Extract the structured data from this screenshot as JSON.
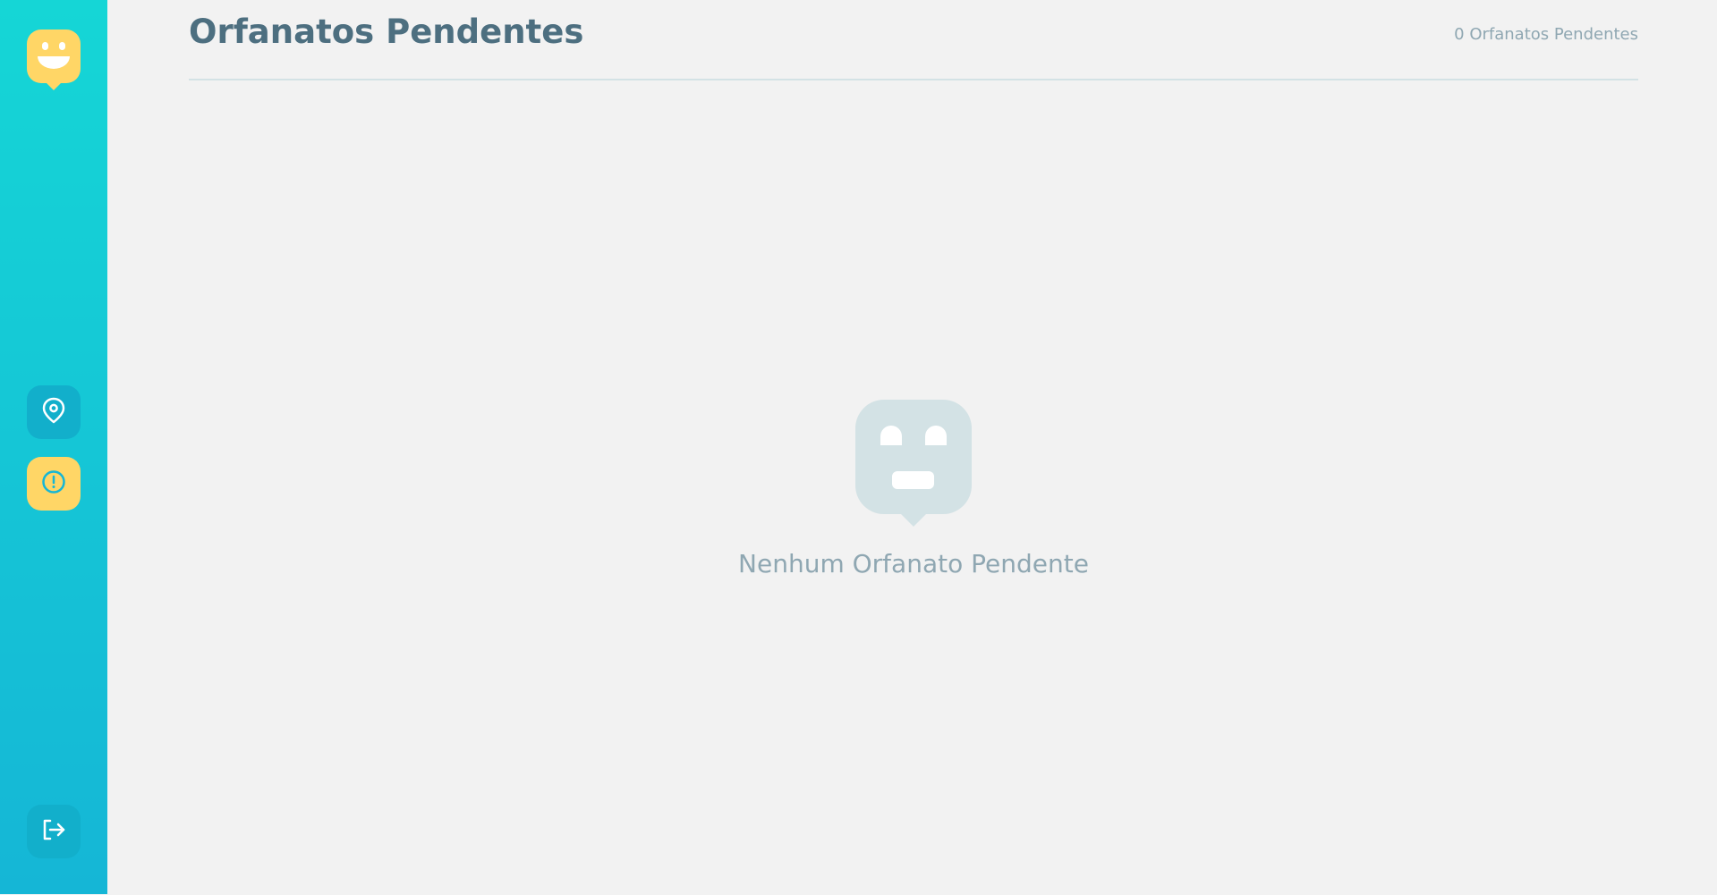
{
  "sidebar": {
    "logo_icon": "happy-face-logo-icon",
    "items": [
      {
        "name": "map-pin-icon",
        "active": false,
        "color": "#12afcb"
      },
      {
        "name": "alert-circle-icon",
        "active": true,
        "color": "#ffd666"
      }
    ],
    "logout_icon": "logout-icon",
    "gradient_colors": [
      "#15d6d6",
      "#15b6d6"
    ]
  },
  "header": {
    "title": "Orfanatos Pendentes",
    "count_text": "0 Orfanatos Pendentes"
  },
  "empty_state": {
    "icon": "neutral-face-icon",
    "message": "Nenhum Orfanato Pendente"
  },
  "colors": {
    "background": "#f2f2f2",
    "title": "#4d6f80",
    "muted_text": "#8fa7b2",
    "divider": "#d3e2e5",
    "accent_yellow": "#ffd666"
  }
}
